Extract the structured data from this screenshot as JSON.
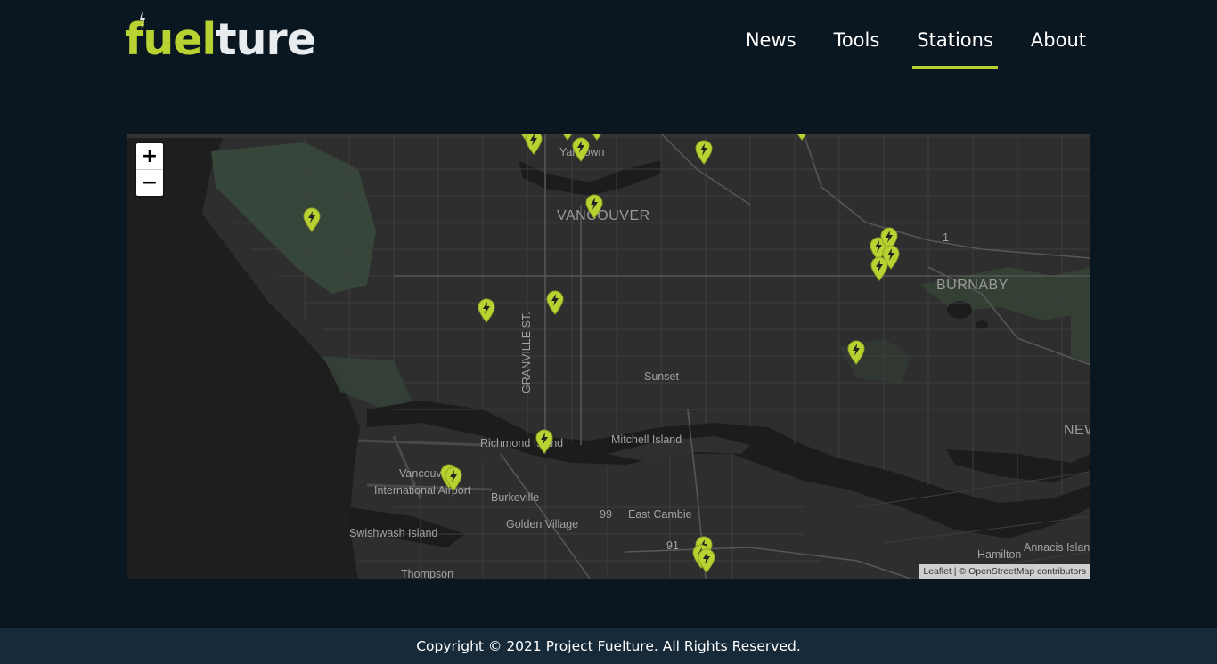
{
  "brand": {
    "logo_part1": "fu",
    "logo_part2": "el",
    "logo_part3": "ture",
    "colors": {
      "accent": "#b8d232",
      "header_bg": "#0b1720",
      "footer_bg": "#172a3a"
    }
  },
  "nav": {
    "items": [
      {
        "label": "News"
      },
      {
        "label": "Tools"
      },
      {
        "label": "Stations",
        "active": true
      },
      {
        "label": "About"
      }
    ]
  },
  "map": {
    "zoom_in": "+",
    "zoom_out": "−",
    "attribution_leaflet": "Leaflet",
    "attribution_sep": "| ©",
    "attribution_osm": "OpenStreetMap contributors",
    "labels": {
      "yaletown": "Yaletown",
      "vancouver": "VANCOUVER",
      "burnaby": "BURNABY",
      "granville": "GRANVILLE ST.",
      "sunset": "Sunset",
      "richmond_island": "Richmond Island",
      "mitchell_island": "Mitchell Island",
      "airport_1": "Vancouver",
      "airport_2": "International Airport",
      "burkeville": "Burkeville",
      "hwy99": "99",
      "east_cambie": "East Cambie",
      "golden_village": "Golden Village",
      "swishwash": "Swishwash Island",
      "hwy91": "91",
      "hwy1": "1",
      "new_westminster": "NEW",
      "hamilton": "Hamilton",
      "annacis": "Annacis Island",
      "thompson": "Thompson"
    },
    "marker_icon": "charging-station-pin-icon"
  },
  "footer": {
    "copyright": "Copyright © 2021 Project Fuelture. All Rights Reserved."
  }
}
